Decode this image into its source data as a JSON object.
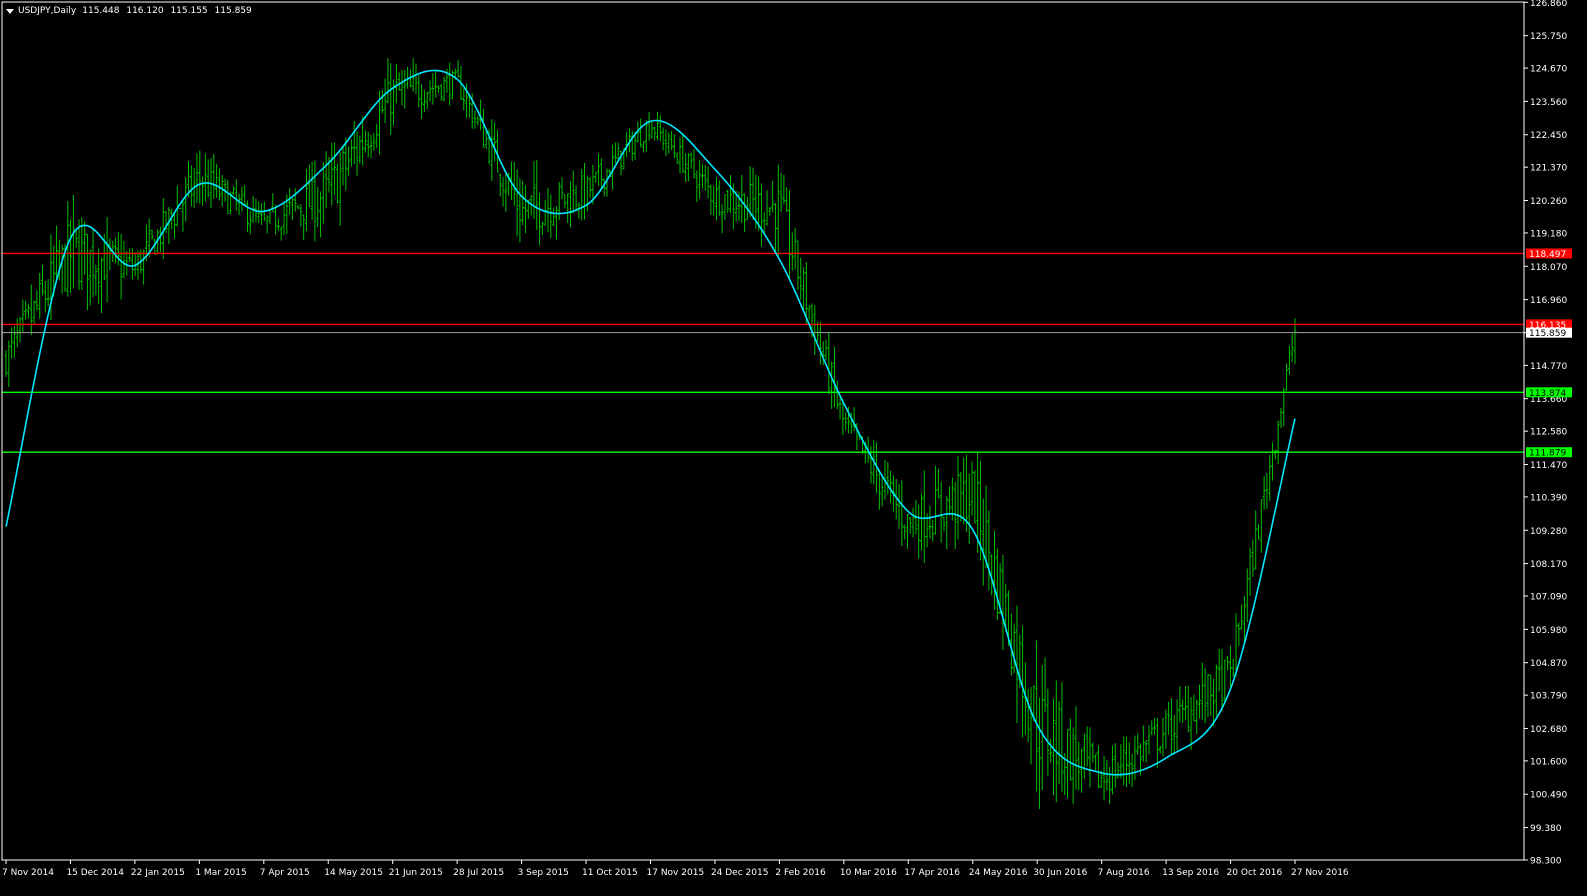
{
  "window": {
    "symbol_label": "USDJPY,Daily",
    "open": "115.448",
    "high": "116.120",
    "low": "115.155",
    "close": "115.859"
  },
  "colors": {
    "background": "#000000",
    "axis": "#ffffff",
    "bars": "#00c000",
    "moving_average": "#00e6ff",
    "resistance": "#ff0000",
    "support": "#00ff00",
    "current_price_line": "#a0a0a0"
  },
  "chart_data": {
    "type": "line",
    "ylim": [
      98.3,
      126.87
    ],
    "y_ticks": [
      "126.860",
      "125.750",
      "124.670",
      "123.560",
      "122.450",
      "121.370",
      "120.260",
      "119.180",
      "118.070",
      "116.960",
      "115.859",
      "114.770",
      "113.660",
      "112.580",
      "111.470",
      "110.390",
      "109.280",
      "108.170",
      "107.090",
      "105.980",
      "104.870",
      "103.790",
      "102.680",
      "101.600",
      "100.490",
      "99.380",
      "98.300"
    ],
    "x_ticks": [
      "7 Nov 2014",
      "15 Dec 2014",
      "22 Jan 2015",
      "1 Mar 2015",
      "7 Apr 2015",
      "14 May 2015",
      "21 Jun 2015",
      "28 Jul 2015",
      "3 Sep 2015",
      "11 Oct 2015",
      "17 Nov 2015",
      "24 Dec 2015",
      "2 Feb 2016",
      "10 Mar 2016",
      "17 Apr 2016",
      "24 May 2016",
      "30 Jun 2016",
      "7 Aug 2016",
      "13 Sep 2016",
      "20 Oct 2016",
      "27 Nov 2016"
    ],
    "levels": [
      {
        "name": "resistance",
        "value": 118.497,
        "label": "118.497"
      },
      {
        "name": "resistance",
        "value": 116.135,
        "label": "116.135"
      },
      {
        "name": "support",
        "value": 113.874,
        "label": "113.874"
      },
      {
        "name": "support",
        "value": 111.879,
        "label": "111.879"
      }
    ],
    "current_price": {
      "value": 115.859,
      "label": "115.859"
    },
    "series": [
      {
        "type": "ohlc_bars",
        "x": [
          "7 Nov 2014",
          "15 Dec 2014",
          "22 Jan 2015",
          "1 Mar 2015",
          "7 Apr 2015",
          "14 May 2015",
          "21 Jun 2015",
          "28 Jul 2015",
          "3 Sep 2015",
          "11 Oct 2015",
          "17 Nov 2015",
          "24 Dec 2015",
          "2 Feb 2016",
          "10 Mar 2016",
          "17 Apr 2016",
          "24 May 2016",
          "30 Jun 2016",
          "7 Aug 2016",
          "13 Sep 2016",
          "20 Oct 2016",
          "27 Nov 2016"
        ],
        "close": [
          115.0,
          118.5,
          118.0,
          121.0,
          119.5,
          120.5,
          123.8,
          124.2,
          119.9,
          120.5,
          122.8,
          120.4,
          120.0,
          112.8,
          109.5,
          110.5,
          102.8,
          101.0,
          102.6,
          104.5,
          115.9
        ],
        "high": [
          116.0,
          121.8,
          119.5,
          122.0,
          120.5,
          124.5,
          125.8,
          125.0,
          121.0,
          121.5,
          123.6,
          121.0,
          121.6,
          114.0,
          111.5,
          111.3,
          107.5,
          103.6,
          103.5,
          105.2,
          116.1
        ],
        "low": [
          113.2,
          115.5,
          116.6,
          118.3,
          118.6,
          119.5,
          122.0,
          123.0,
          116.2,
          118.5,
          121.7,
          118.2,
          117.0,
          111.0,
          107.6,
          106.0,
          99.0,
          99.8,
          100.2,
          101.3,
          113.7
        ]
      },
      {
        "type": "moving_average",
        "x": [
          "7 Nov 2014",
          "15 Dec 2014",
          "22 Jan 2015",
          "1 Mar 2015",
          "7 Apr 2015",
          "14 May 2015",
          "21 Jun 2015",
          "28 Jul 2015",
          "3 Sep 2015",
          "11 Oct 2015",
          "17 Nov 2015",
          "24 Dec 2015",
          "2 Feb 2016",
          "10 Mar 2016",
          "17 Apr 2016",
          "24 May 2016",
          "30 Jun 2016",
          "7 Aug 2016",
          "13 Sep 2016",
          "20 Oct 2016",
          "27 Nov 2016"
        ],
        "values": [
          109.4,
          119.0,
          118.1,
          120.8,
          119.9,
          121.5,
          124.0,
          124.3,
          120.4,
          120.1,
          122.9,
          121.3,
          118.3,
          113.5,
          109.9,
          109.3,
          102.8,
          101.2,
          101.7,
          104.0,
          113.0
        ]
      }
    ]
  }
}
